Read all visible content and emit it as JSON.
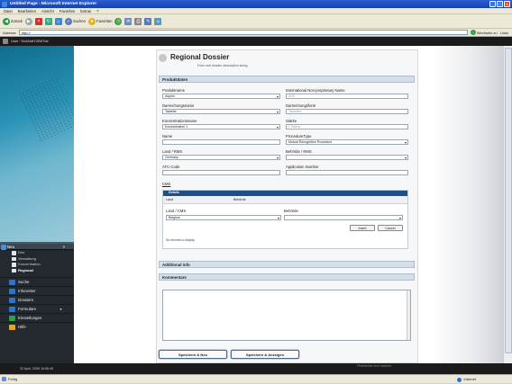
{
  "window": {
    "title": "Untitled Page - Microsoft Internet Explorer",
    "buttons": [
      "_",
      "□",
      "×"
    ]
  },
  "menu": [
    "Datei",
    "Bearbeiten",
    "Ansicht",
    "Favoriten",
    "Extras",
    "?"
  ],
  "toolbar": {
    "back_label": "Zurück",
    "search_label": "Suchen",
    "favorites_label": "Favoriten"
  },
  "address": {
    "label": "Adresse",
    "value": "http://",
    "go_label": "Wechseln zu",
    "links_label": "Links"
  },
  "appbar": {
    "user_text": "User: '3h4Ab8Y2B5Tuk'"
  },
  "nav": {
    "header": "Neu",
    "subitems": [
      "Drei",
      "Verwaltung",
      "Konzentration",
      "Regional"
    ],
    "items": [
      {
        "label": "Suche",
        "icon": "search-icon",
        "color": "#2f74c8"
      },
      {
        "label": "Infocenter",
        "icon": "info-icon",
        "color": "#2f74c8"
      },
      {
        "label": "Dossiers",
        "icon": "folder-icon",
        "color": "#2f74c8"
      },
      {
        "label": "Formulare",
        "icon": "form-icon",
        "color": "#2f74c8"
      },
      {
        "label": "Einstellungen",
        "icon": "settings-icon",
        "color": "#2fa04a"
      },
      {
        "label": "Hilfe",
        "icon": "help-icon",
        "color": "#e0a81c"
      }
    ]
  },
  "form": {
    "title": "Regional Dossier",
    "subtitle": "Form sub header description string",
    "section_productdata": "Produktdaten",
    "fields": {
      "produktname": {
        "label": "Produktname",
        "value": "Aspirin"
      },
      "inn": {
        "label": "International Non-proprietary Name",
        "value": "ASS"
      },
      "darreichungsname": {
        "label": "Darreichungsname",
        "value": "Tablette"
      },
      "darreichungsform": {
        "label": "Darreichungsform",
        "value": "Tabletten"
      },
      "konzentrationsname": {
        "label": "Konzentrationsname",
        "value": "Konzentration 1"
      },
      "staerke": {
        "label": "Stärke",
        "value": "2 Stärke"
      },
      "name": {
        "label": "Name",
        "value": ""
      },
      "proceduretype": {
        "label": "ProcedureType",
        "value": "Mutual Recognition Procedure"
      },
      "land": {
        "label": "Land / RMS",
        "value": "Germany"
      },
      "behoerde": {
        "label": "Behörde / RMS",
        "value": ""
      },
      "atc": {
        "label": "ATC-Code",
        "value": ""
      },
      "appnumber": {
        "label": "Application Number",
        "value": ""
      }
    },
    "cms": {
      "label": "CMS",
      "panel_title": "Details",
      "col_land": "Land",
      "col_behoerde": "Behörde",
      "land_label": "Land / CMS",
      "land_value": "Belgium",
      "behoerde_label": "Behörde",
      "insert_label": "Insert",
      "cancel_label": "Cancel",
      "empty_text": "No records to display."
    },
    "section_additional": "Additional info",
    "section_comments": "Kommentare",
    "save_new_label": "Speichern & Neu",
    "save_show_label": "Speichern & Anzeigen",
    "footer_hint": "Pflichtfelder sind markiert"
  },
  "timestamp": "22 April, 2009 16:56:49",
  "status": {
    "left": "Fertig",
    "right": "Internet"
  }
}
